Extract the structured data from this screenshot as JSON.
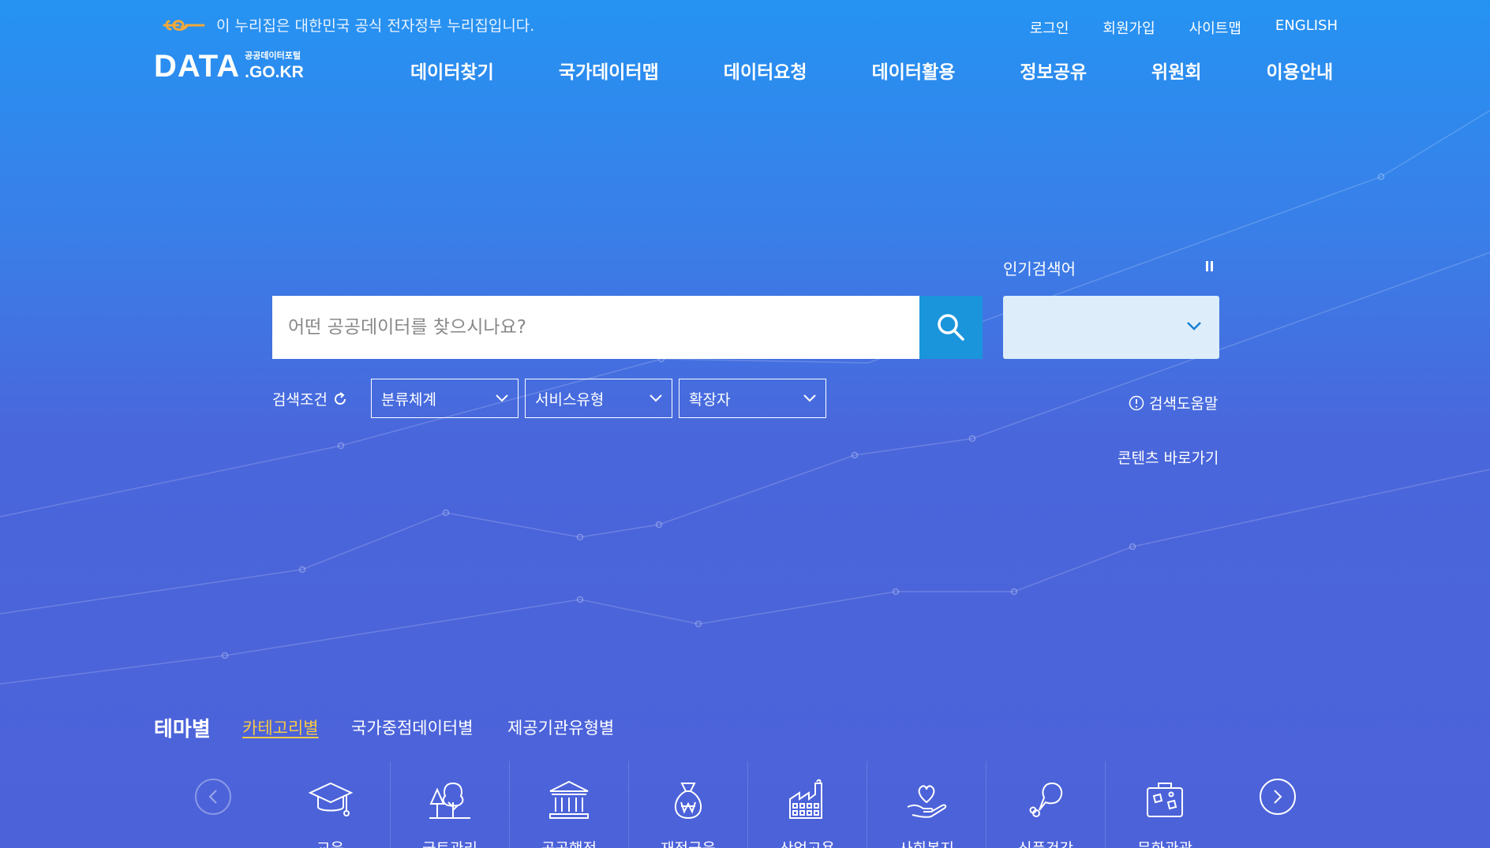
{
  "gov_banner": {
    "text": "이 누리집은 대한민국 공식 전자정부 누리집입니다."
  },
  "util_links": [
    "로그인",
    "회원가입",
    "사이트맵",
    "ENGLISH"
  ],
  "logo": {
    "main": "DATA",
    "sub_small": "공공데이터포털",
    "sub_big": ".GO.KR"
  },
  "gnb": [
    "데이터찾기",
    "국가데이터맵",
    "데이터요청",
    "데이터활용",
    "정보공유",
    "위원회",
    "이용안내"
  ],
  "search": {
    "placeholder": "어떤 공공데이터를 찾으시나요?"
  },
  "popular": {
    "title": "인기검색어"
  },
  "conditions": {
    "label": "검색조건",
    "dropdowns": [
      "분류체계",
      "서비스유형",
      "확장자"
    ]
  },
  "help": "검색도움말",
  "shortcut": "콘텐츠 바로가기",
  "theme": {
    "title": "테마별",
    "tabs": [
      "카테고리별",
      "국가중점데이터별",
      "제공기관유형별"
    ]
  },
  "categories": [
    {
      "label": "교육",
      "icon": "graduation-cap-icon"
    },
    {
      "label": "국토관리",
      "icon": "trees-icon"
    },
    {
      "label": "공공행정",
      "icon": "government-building-icon"
    },
    {
      "label": "재정금융",
      "icon": "money-bag-icon"
    },
    {
      "label": "산업고용",
      "icon": "factory-icon"
    },
    {
      "label": "사회복지",
      "icon": "heart-hand-icon"
    },
    {
      "label": "식품건강",
      "icon": "chicken-leg-icon"
    },
    {
      "label": "문화관광",
      "icon": "suitcase-icon"
    }
  ],
  "colors": {
    "accent_tab": "#f6c945",
    "search_button": "#1a95dc",
    "popular_bg": "#ddeefa"
  }
}
